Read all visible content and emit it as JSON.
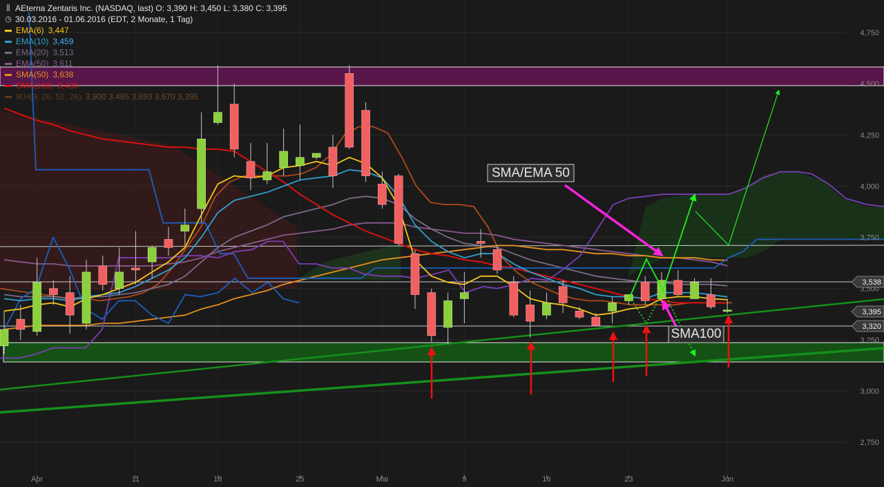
{
  "header": {
    "icon": "candlestick-chart-icon",
    "title": "AEterna Zentaris Inc. (NASDAQ, last)  O: 3,390  H: 3,450  L: 3,380  C: 3,395",
    "range_icon": "clock-icon",
    "range": "30.03.2016 - 01.06.2016 (EDT, 2 Monate, 1 Tag)"
  },
  "legend": [
    {
      "label": "EMA(6)",
      "value": "3,447",
      "color": "#f5c518"
    },
    {
      "label": "EMA(10)",
      "value": "3,459",
      "color": "#2f9fd0"
    },
    {
      "label": "EMA(20)",
      "value": "3,513",
      "color": "#7d6a88"
    },
    {
      "label": "EMA(50)",
      "value": "3,611",
      "color": "#8a5a8f"
    },
    {
      "label": "SMA(50)",
      "value": "3,638",
      "color": "#e8901e"
    },
    {
      "label": "SMA(100)",
      "value": "3,430",
      "color": "#d81010"
    },
    {
      "label": "IKH(9, 26, 52, 26)",
      "value": "3,900  3,485  3,693  3,670  3,395",
      "color": "#5c3a20"
    }
  ],
  "chart_data": {
    "type": "candlestick",
    "ylim": [
      2.62,
      4.86
    ],
    "y_ticks": [
      "2,750",
      "3,000",
      "3,250",
      "3,500",
      "3,750",
      "4,000",
      "4,250",
      "4,500",
      "4,750"
    ],
    "x_ticks": [
      "Apr",
      "11",
      "18",
      "25",
      "Mai",
      "9",
      "16",
      "23",
      "Jun"
    ],
    "candles": [
      {
        "o": 3.22,
        "h": 3.39,
        "l": 3.18,
        "c": 3.3
      },
      {
        "o": 3.35,
        "h": 3.42,
        "l": 3.25,
        "c": 3.3
      },
      {
        "o": 3.29,
        "h": 3.65,
        "l": 3.27,
        "c": 3.53
      },
      {
        "o": 3.5,
        "h": 3.54,
        "l": 3.42,
        "c": 3.47
      },
      {
        "o": 3.48,
        "h": 3.56,
        "l": 3.28,
        "c": 3.37
      },
      {
        "o": 3.33,
        "h": 3.64,
        "l": 3.3,
        "c": 3.58
      },
      {
        "o": 3.61,
        "h": 3.66,
        "l": 3.49,
        "c": 3.52
      },
      {
        "o": 3.5,
        "h": 3.7,
        "l": 3.47,
        "c": 3.58
      },
      {
        "o": 3.6,
        "h": 3.78,
        "l": 3.52,
        "c": 3.59
      },
      {
        "o": 3.63,
        "h": 3.71,
        "l": 3.55,
        "c": 3.7
      },
      {
        "o": 3.74,
        "h": 3.8,
        "l": 3.66,
        "c": 3.7
      },
      {
        "o": 3.78,
        "h": 3.89,
        "l": 3.71,
        "c": 3.81
      },
      {
        "o": 3.89,
        "h": 4.36,
        "l": 3.82,
        "c": 4.23
      },
      {
        "o": 4.31,
        "h": 4.59,
        "l": 4.3,
        "c": 4.36
      },
      {
        "o": 4.4,
        "h": 4.5,
        "l": 4.14,
        "c": 4.18
      },
      {
        "o": 4.12,
        "h": 4.21,
        "l": 3.98,
        "c": 4.04
      },
      {
        "o": 4.03,
        "h": 4.21,
        "l": 4.01,
        "c": 4.07
      },
      {
        "o": 4.09,
        "h": 4.28,
        "l": 4.05,
        "c": 4.17
      },
      {
        "o": 4.1,
        "h": 4.3,
        "l": 4.03,
        "c": 4.14
      },
      {
        "o": 4.14,
        "h": 4.15,
        "l": 4.13,
        "c": 4.16
      },
      {
        "o": 4.19,
        "h": 4.25,
        "l": 3.99,
        "c": 4.05
      },
      {
        "o": 4.55,
        "h": 4.59,
        "l": 4.18,
        "c": 4.19
      },
      {
        "o": 4.37,
        "h": 4.41,
        "l": 4.02,
        "c": 4.05
      },
      {
        "o": 4.01,
        "h": 4.07,
        "l": 3.89,
        "c": 3.91
      },
      {
        "o": 4.05,
        "h": 4.06,
        "l": 3.71,
        "c": 3.72
      },
      {
        "o": 3.67,
        "h": 3.69,
        "l": 3.4,
        "c": 3.47
      },
      {
        "o": 3.48,
        "h": 3.5,
        "l": 3.24,
        "c": 3.27
      },
      {
        "o": 3.31,
        "h": 3.48,
        "l": 3.23,
        "c": 3.44
      },
      {
        "o": 3.45,
        "h": 3.58,
        "l": 3.33,
        "c": 3.48
      },
      {
        "o": 3.73,
        "h": 3.79,
        "l": 3.65,
        "c": 3.72
      },
      {
        "o": 3.69,
        "h": 3.71,
        "l": 3.57,
        "c": 3.59
      },
      {
        "o": 3.53,
        "h": 3.56,
        "l": 3.36,
        "c": 3.37
      },
      {
        "o": 3.42,
        "h": 3.49,
        "l": 3.26,
        "c": 3.34
      },
      {
        "o": 3.37,
        "h": 3.48,
        "l": 3.35,
        "c": 3.43
      },
      {
        "o": 3.51,
        "h": 3.54,
        "l": 3.38,
        "c": 3.43
      },
      {
        "o": 3.39,
        "h": 3.41,
        "l": 3.35,
        "c": 3.36
      },
      {
        "o": 3.36,
        "h": 3.38,
        "l": 3.32,
        "c": 3.32
      },
      {
        "o": 3.39,
        "h": 3.46,
        "l": 3.33,
        "c": 3.43
      },
      {
        "o": 3.44,
        "h": 3.47,
        "l": 3.42,
        "c": 3.47
      },
      {
        "o": 3.53,
        "h": 3.56,
        "l": 3.42,
        "c": 3.44
      },
      {
        "o": 3.45,
        "h": 3.58,
        "l": 3.43,
        "c": 3.54
      },
      {
        "o": 3.54,
        "h": 3.59,
        "l": 3.46,
        "c": 3.47
      },
      {
        "o": 3.45,
        "h": 3.55,
        "l": 3.45,
        "c": 3.53
      },
      {
        "o": 3.47,
        "h": 3.55,
        "l": 3.4,
        "c": 3.41
      },
      {
        "o": 3.39,
        "h": 3.45,
        "l": 3.38,
        "c": 3.395
      }
    ],
    "series": [
      {
        "name": "EMA(6)",
        "color": "#f5c518",
        "values": [
          3.39,
          3.4,
          3.42,
          3.43,
          3.41,
          3.45,
          3.47,
          3.5,
          3.53,
          3.58,
          3.63,
          3.7,
          3.86,
          4.01,
          4.05,
          4.04,
          4.05,
          4.09,
          4.1,
          4.12,
          4.1,
          4.14,
          4.11,
          4.04,
          3.9,
          3.64,
          3.56,
          3.53,
          3.52,
          3.56,
          3.56,
          3.51,
          3.45,
          3.43,
          3.42,
          3.4,
          3.37,
          3.38,
          3.4,
          3.41,
          3.45,
          3.46,
          3.46,
          3.45,
          3.445
        ]
      },
      {
        "name": "EMA(10)",
        "color": "#2f9fd0",
        "values": [
          3.45,
          3.44,
          3.45,
          3.45,
          3.44,
          3.46,
          3.47,
          3.48,
          3.51,
          3.55,
          3.59,
          3.65,
          3.75,
          3.87,
          3.93,
          3.95,
          3.97,
          4.0,
          4.03,
          4.04,
          4.05,
          4.08,
          4.07,
          4.04,
          3.95,
          3.81,
          3.73,
          3.68,
          3.65,
          3.67,
          3.67,
          3.62,
          3.58,
          3.55,
          3.52,
          3.5,
          3.47,
          3.46,
          3.46,
          3.45,
          3.48,
          3.48,
          3.48,
          3.47,
          3.459
        ]
      },
      {
        "name": "EMA(20)",
        "color": "#7d6a88",
        "values": [
          3.47,
          3.46,
          3.46,
          3.46,
          3.45,
          3.46,
          3.46,
          3.47,
          3.48,
          3.5,
          3.52,
          3.56,
          3.63,
          3.7,
          3.75,
          3.78,
          3.81,
          3.85,
          3.87,
          3.89,
          3.91,
          3.94,
          3.95,
          3.94,
          3.91,
          3.84,
          3.79,
          3.75,
          3.72,
          3.71,
          3.7,
          3.67,
          3.64,
          3.62,
          3.6,
          3.58,
          3.56,
          3.55,
          3.54,
          3.53,
          3.53,
          3.52,
          3.52,
          3.52,
          3.513
        ]
      },
      {
        "name": "EMA(50)",
        "color": "#8a5a8f",
        "values": [
          3.64,
          3.63,
          3.62,
          3.62,
          3.61,
          3.61,
          3.61,
          3.61,
          3.61,
          3.61,
          3.62,
          3.63,
          3.65,
          3.68,
          3.7,
          3.72,
          3.74,
          3.76,
          3.77,
          3.78,
          3.79,
          3.81,
          3.82,
          3.82,
          3.82,
          3.8,
          3.79,
          3.78,
          3.77,
          3.77,
          3.76,
          3.74,
          3.73,
          3.72,
          3.71,
          3.7,
          3.69,
          3.68,
          3.67,
          3.66,
          3.65,
          3.65,
          3.64,
          3.63,
          3.611
        ]
      },
      {
        "name": "SMA(50)",
        "color": "#e8901e",
        "values": [
          3.3,
          3.31,
          3.32,
          3.32,
          3.32,
          3.32,
          3.33,
          3.33,
          3.34,
          3.35,
          3.36,
          3.37,
          3.4,
          3.42,
          3.45,
          3.47,
          3.49,
          3.52,
          3.54,
          3.56,
          3.58,
          3.6,
          3.62,
          3.64,
          3.65,
          3.66,
          3.67,
          3.68,
          3.69,
          3.7,
          3.71,
          3.71,
          3.7,
          3.69,
          3.69,
          3.68,
          3.67,
          3.67,
          3.66,
          3.66,
          3.65,
          3.65,
          3.65,
          3.64,
          3.638
        ]
      },
      {
        "name": "SMA(100)",
        "color": "#d81010",
        "values": [
          4.38,
          4.35,
          4.32,
          4.3,
          4.27,
          4.25,
          4.23,
          4.22,
          4.21,
          4.2,
          4.19,
          4.19,
          4.18,
          4.18,
          4.17,
          4.12,
          4.07,
          4.02,
          3.96,
          3.91,
          3.86,
          3.82,
          3.78,
          3.75,
          3.72,
          3.69,
          3.67,
          3.66,
          3.64,
          3.63,
          3.61,
          3.6,
          3.58,
          3.56,
          3.54,
          3.52,
          3.5,
          3.48,
          3.46,
          3.45,
          3.44,
          3.43,
          3.43,
          3.43,
          3.43
        ]
      },
      {
        "name": "IKH Tenkan",
        "color": "#1d5fbf",
        "values": [
          3.3,
          3.45,
          3.5,
          3.75,
          3.6,
          3.4,
          3.35,
          3.44,
          3.44,
          3.37,
          3.33,
          3.47,
          3.46,
          3.48,
          3.55,
          3.48,
          3.53,
          3.45,
          3.43
        ]
      },
      {
        "name": "IKH Kijun",
        "color": "#1d5fbf",
        "values": [
          4.85,
          4.08,
          4.08,
          4.08,
          4.08,
          4.08,
          4.08,
          4.08,
          4.08,
          4.08,
          3.82,
          3.82,
          3.82,
          3.82,
          3.67,
          3.67,
          3.55,
          3.55,
          3.55,
          3.55,
          3.55,
          3.55,
          3.55,
          3.55,
          3.55,
          3.6,
          3.6,
          3.6,
          3.6,
          3.6,
          3.6,
          3.6,
          3.6,
          3.6,
          3.6,
          3.6,
          3.6,
          3.6,
          3.6,
          3.6,
          3.6,
          3.6,
          3.6,
          3.6,
          3.6,
          3.6,
          3.6,
          3.6,
          3.6,
          3.6,
          3.65,
          3.68,
          3.74,
          3.74,
          3.74,
          3.74,
          3.74,
          3.74,
          3.74,
          3.74,
          3.74,
          3.74
        ]
      },
      {
        "name": "IKH Chikou",
        "color": "#7a3fb5",
        "values": [
          3.16,
          3.16,
          3.18,
          3.21,
          3.21,
          3.21,
          3.3,
          3.65,
          3.65,
          3.65,
          3.65,
          3.66,
          3.66,
          3.65,
          3.68,
          3.69,
          3.73,
          3.73,
          3.62,
          3.62,
          3.6,
          3.6,
          3.57,
          3.56,
          3.56,
          3.55,
          3.57,
          3.59,
          3.48,
          3.51,
          3.5,
          3.52,
          3.55,
          3.54,
          3.6,
          3.66,
          3.79,
          3.91,
          3.94,
          3.95,
          3.96,
          3.96,
          3.96,
          3.96,
          3.96,
          3.99,
          4.04,
          4.07,
          4.07,
          4.06,
          4.01,
          3.94,
          3.91,
          3.9
        ]
      },
      {
        "name": "IKH Senkou",
        "color": "#b04a1c",
        "values": [
          3.5,
          3.49,
          3.48,
          3.47,
          3.46,
          3.45,
          3.45,
          3.44,
          3.45,
          3.46,
          3.48,
          3.52,
          3.6,
          3.7,
          3.8,
          3.95,
          4.02,
          4.05,
          4.05,
          4.05,
          4.05,
          4.06,
          4.09,
          4.15,
          4.25,
          4.29,
          4.29,
          4.26,
          4.14,
          4.0,
          3.92,
          3.91,
          3.91,
          3.9,
          3.8,
          3.65,
          3.58,
          3.53,
          3.5,
          3.47,
          3.45,
          3.44,
          3.44,
          3.43,
          3.42,
          3.42,
          3.42,
          3.42,
          3.43,
          3.43,
          3.43,
          3.43
        ]
      }
    ],
    "price_labels": [
      "3,538",
      "3,395",
      "3,320"
    ],
    "annotations": [
      "SMA/EMA 50",
      "SMA100"
    ]
  }
}
